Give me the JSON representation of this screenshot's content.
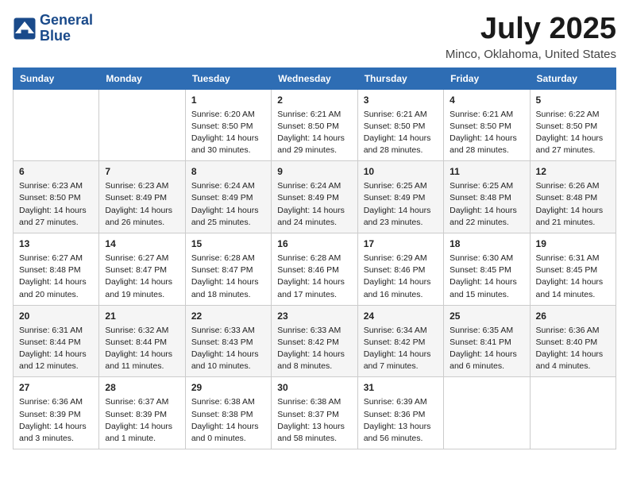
{
  "header": {
    "logo_line1": "General",
    "logo_line2": "Blue",
    "month_year": "July 2025",
    "location": "Minco, Oklahoma, United States"
  },
  "weekdays": [
    "Sunday",
    "Monday",
    "Tuesday",
    "Wednesday",
    "Thursday",
    "Friday",
    "Saturday"
  ],
  "weeks": [
    [
      {
        "day": "",
        "info": ""
      },
      {
        "day": "",
        "info": ""
      },
      {
        "day": "1",
        "info": "Sunrise: 6:20 AM\nSunset: 8:50 PM\nDaylight: 14 hours\nand 30 minutes."
      },
      {
        "day": "2",
        "info": "Sunrise: 6:21 AM\nSunset: 8:50 PM\nDaylight: 14 hours\nand 29 minutes."
      },
      {
        "day": "3",
        "info": "Sunrise: 6:21 AM\nSunset: 8:50 PM\nDaylight: 14 hours\nand 28 minutes."
      },
      {
        "day": "4",
        "info": "Sunrise: 6:21 AM\nSunset: 8:50 PM\nDaylight: 14 hours\nand 28 minutes."
      },
      {
        "day": "5",
        "info": "Sunrise: 6:22 AM\nSunset: 8:50 PM\nDaylight: 14 hours\nand 27 minutes."
      }
    ],
    [
      {
        "day": "6",
        "info": "Sunrise: 6:23 AM\nSunset: 8:50 PM\nDaylight: 14 hours\nand 27 minutes."
      },
      {
        "day": "7",
        "info": "Sunrise: 6:23 AM\nSunset: 8:49 PM\nDaylight: 14 hours\nand 26 minutes."
      },
      {
        "day": "8",
        "info": "Sunrise: 6:24 AM\nSunset: 8:49 PM\nDaylight: 14 hours\nand 25 minutes."
      },
      {
        "day": "9",
        "info": "Sunrise: 6:24 AM\nSunset: 8:49 PM\nDaylight: 14 hours\nand 24 minutes."
      },
      {
        "day": "10",
        "info": "Sunrise: 6:25 AM\nSunset: 8:49 PM\nDaylight: 14 hours\nand 23 minutes."
      },
      {
        "day": "11",
        "info": "Sunrise: 6:25 AM\nSunset: 8:48 PM\nDaylight: 14 hours\nand 22 minutes."
      },
      {
        "day": "12",
        "info": "Sunrise: 6:26 AM\nSunset: 8:48 PM\nDaylight: 14 hours\nand 21 minutes."
      }
    ],
    [
      {
        "day": "13",
        "info": "Sunrise: 6:27 AM\nSunset: 8:48 PM\nDaylight: 14 hours\nand 20 minutes."
      },
      {
        "day": "14",
        "info": "Sunrise: 6:27 AM\nSunset: 8:47 PM\nDaylight: 14 hours\nand 19 minutes."
      },
      {
        "day": "15",
        "info": "Sunrise: 6:28 AM\nSunset: 8:47 PM\nDaylight: 14 hours\nand 18 minutes."
      },
      {
        "day": "16",
        "info": "Sunrise: 6:28 AM\nSunset: 8:46 PM\nDaylight: 14 hours\nand 17 minutes."
      },
      {
        "day": "17",
        "info": "Sunrise: 6:29 AM\nSunset: 8:46 PM\nDaylight: 14 hours\nand 16 minutes."
      },
      {
        "day": "18",
        "info": "Sunrise: 6:30 AM\nSunset: 8:45 PM\nDaylight: 14 hours\nand 15 minutes."
      },
      {
        "day": "19",
        "info": "Sunrise: 6:31 AM\nSunset: 8:45 PM\nDaylight: 14 hours\nand 14 minutes."
      }
    ],
    [
      {
        "day": "20",
        "info": "Sunrise: 6:31 AM\nSunset: 8:44 PM\nDaylight: 14 hours\nand 12 minutes."
      },
      {
        "day": "21",
        "info": "Sunrise: 6:32 AM\nSunset: 8:44 PM\nDaylight: 14 hours\nand 11 minutes."
      },
      {
        "day": "22",
        "info": "Sunrise: 6:33 AM\nSunset: 8:43 PM\nDaylight: 14 hours\nand 10 minutes."
      },
      {
        "day": "23",
        "info": "Sunrise: 6:33 AM\nSunset: 8:42 PM\nDaylight: 14 hours\nand 8 minutes."
      },
      {
        "day": "24",
        "info": "Sunrise: 6:34 AM\nSunset: 8:42 PM\nDaylight: 14 hours\nand 7 minutes."
      },
      {
        "day": "25",
        "info": "Sunrise: 6:35 AM\nSunset: 8:41 PM\nDaylight: 14 hours\nand 6 minutes."
      },
      {
        "day": "26",
        "info": "Sunrise: 6:36 AM\nSunset: 8:40 PM\nDaylight: 14 hours\nand 4 minutes."
      }
    ],
    [
      {
        "day": "27",
        "info": "Sunrise: 6:36 AM\nSunset: 8:39 PM\nDaylight: 14 hours\nand 3 minutes."
      },
      {
        "day": "28",
        "info": "Sunrise: 6:37 AM\nSunset: 8:39 PM\nDaylight: 14 hours\nand 1 minute."
      },
      {
        "day": "29",
        "info": "Sunrise: 6:38 AM\nSunset: 8:38 PM\nDaylight: 14 hours\nand 0 minutes."
      },
      {
        "day": "30",
        "info": "Sunrise: 6:38 AM\nSunset: 8:37 PM\nDaylight: 13 hours\nand 58 minutes."
      },
      {
        "day": "31",
        "info": "Sunrise: 6:39 AM\nSunset: 8:36 PM\nDaylight: 13 hours\nand 56 minutes."
      },
      {
        "day": "",
        "info": ""
      },
      {
        "day": "",
        "info": ""
      }
    ]
  ]
}
